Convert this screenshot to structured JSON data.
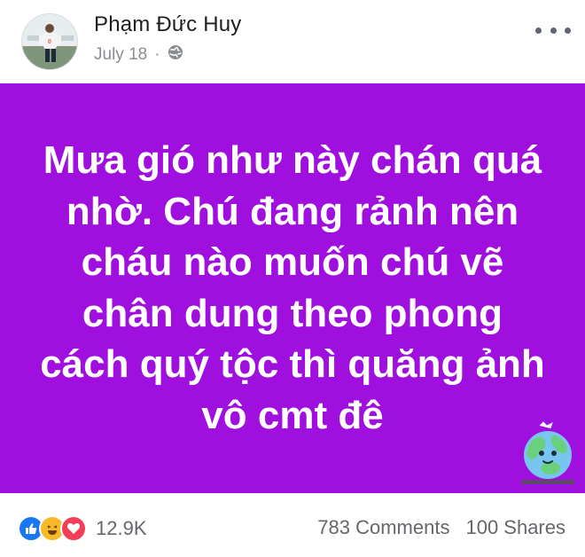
{
  "post": {
    "author": "Phạm Đức Huy",
    "date": "July 18",
    "separator": "·",
    "text": "Mưa gió như này chán quá nhờ. Chú đang rảnh nên cháu nào muốn chú vẽ chân dung theo phong cách quý tộc thì quăng ảnh vô cmt đê",
    "background_color": "#9f0fde"
  },
  "stats": {
    "reactions_count": "12.9K",
    "comments": "783 Comments",
    "shares": "100 Shares"
  },
  "icons": {
    "privacy": "globe-icon",
    "more": "more-icon",
    "like": "like-reaction-icon",
    "haha": "haha-reaction-icon",
    "love": "love-reaction-icon"
  }
}
